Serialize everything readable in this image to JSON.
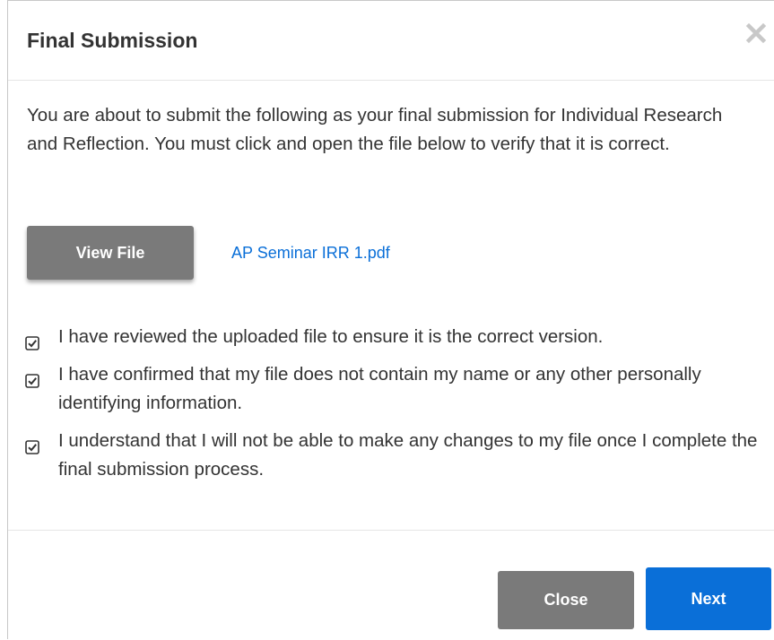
{
  "dialog": {
    "title": "Final Submission",
    "close_icon": "close-x-icon"
  },
  "body": {
    "intro": "You are about to submit the following as your final submission for Individual Research and Reflection. You must click and open the file below to verify that it is correct.",
    "view_file_label": "View File",
    "file_name": "AP Seminar IRR 1.pdf",
    "checkboxes": [
      {
        "label": "I have reviewed the uploaded file to ensure it is the correct version.",
        "checked": true
      },
      {
        "label": "I have confirmed that my file does not contain my name or any other personally identifying information.",
        "checked": true
      },
      {
        "label": "I understand that I will not be able to make any changes to my file once I complete the final submission process.",
        "checked": true
      }
    ]
  },
  "footer": {
    "close_label": "Close",
    "next_label": "Next"
  },
  "colors": {
    "primary": "#0a6fd8",
    "secondary_button": "#7a7a7a",
    "text": "#333333"
  }
}
